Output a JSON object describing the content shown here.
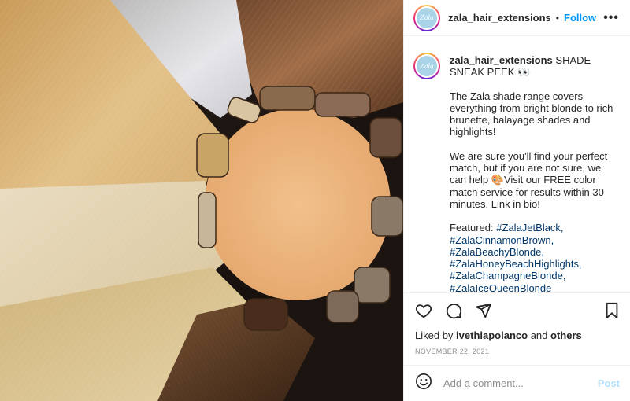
{
  "photo": {
    "alt_subject": "hair-extensions-circle-photo"
  },
  "header": {
    "avatar_text": "Zala",
    "username": "zala_hair_extensions",
    "separator": "•",
    "follow_label": "Follow",
    "more_label": "•••"
  },
  "caption": {
    "username": "zala_hair_extensions",
    "headline": "SHADE SNEAK PEEK 👀",
    "paragraph1": "The Zala shade range covers everything from bright blonde to rich brunette, balayage shades and highlights!",
    "paragraph2": "We are sure you'll find your perfect match, but if you are not sure, we can help 🎨Visit our FREE color match service for results within 30 minutes. Link in bio!",
    "featured_label": "Featured:",
    "hashtags": [
      "#ZalaJetBlack,",
      "#ZalaCinnamonBrown,",
      "#ZalaBeachyBlonde,",
      "#ZalaHoneyBeachHighlights,",
      "#ZalaChampagneBlonde,",
      "#ZalaIceQueenBlonde"
    ]
  },
  "actions": {
    "like_icon": "heart-icon",
    "comment_icon": "comment-icon",
    "share_icon": "share-icon",
    "save_icon": "bookmark-icon"
  },
  "likes": {
    "prefix": "Liked by",
    "user": "ivethiapolanco",
    "conj": "and",
    "others": "others"
  },
  "date": "NOVEMBER 22, 2021",
  "comment": {
    "emoji_icon": "smiley-icon",
    "placeholder": "Add a comment...",
    "post_label": "Post"
  },
  "colors": {
    "follow": "#0095f6",
    "hashtag": "#00376b",
    "post_disabled": "#b2dffc",
    "photo_center": "#efba86"
  }
}
